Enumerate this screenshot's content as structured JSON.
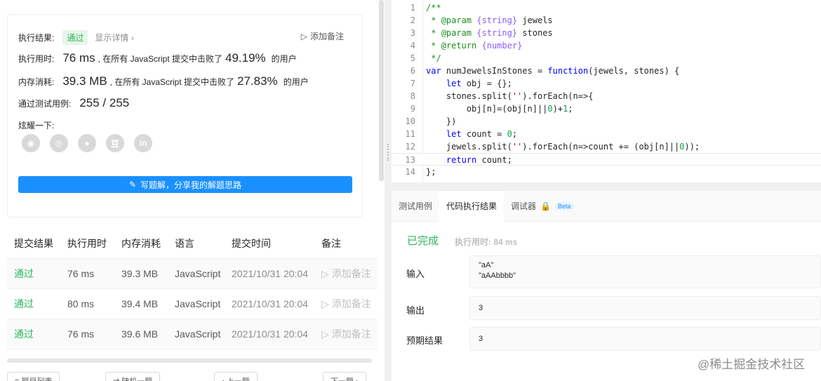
{
  "summary": {
    "result_label": "执行结果:",
    "result_value": "通过",
    "show_detail": "显示详情 ›",
    "add_note": "添加备注",
    "time_label": "执行用时:",
    "time_value": "76 ms",
    "time_text": ", 在所有 JavaScript 提交中击败了",
    "time_pct": "49.19%",
    "time_suffix": "的用户",
    "mem_label": "内存消耗:",
    "mem_value": "39.3 MB",
    "mem_text": ", 在所有 JavaScript 提交中击败了",
    "mem_pct": "27.83%",
    "mem_suffix": "的用户",
    "cases_label": "通过测试用例:",
    "cases_value": "255 / 255",
    "share_label": "炫耀一下:",
    "share_icons": [
      "wechat-icon",
      "weibo-icon",
      "qq-icon",
      "douban-icon",
      "linkedin-icon"
    ],
    "share_glyphs": [
      "◉",
      "◎",
      "●",
      "豆",
      "in"
    ],
    "write_solution": "写题解，分享我的解题思路"
  },
  "submissions": {
    "headers": [
      "提交结果",
      "执行用时",
      "内存消耗",
      "语言",
      "提交时间",
      "备注"
    ],
    "rows": [
      {
        "result": "通过",
        "time": "76 ms",
        "memory": "39.3 MB",
        "lang": "JavaScript",
        "date": "2021/10/31 20:04",
        "note": "添加备注"
      },
      {
        "result": "通过",
        "time": "80 ms",
        "memory": "39.4 MB",
        "lang": "JavaScript",
        "date": "2021/10/31 20:04",
        "note": "添加备注"
      },
      {
        "result": "通过",
        "time": "76 ms",
        "memory": "39.6 MB",
        "lang": "JavaScript",
        "date": "2021/10/31 20:04",
        "note": "添加备注"
      }
    ]
  },
  "editor": {
    "lines": [
      {
        "n": "1",
        "html": "<span class='cm'>/**</span>"
      },
      {
        "n": "2",
        "html": "<span class='cm'> * </span><span class='cm'>@param</span> <span class='ty'>{string}</span> jewels"
      },
      {
        "n": "3",
        "html": "<span class='cm'> * </span><span class='cm'>@param</span> <span class='ty'>{string}</span> stones"
      },
      {
        "n": "4",
        "html": "<span class='cm'> * </span><span class='cm'>@return</span> <span class='ty'>{number}</span>"
      },
      {
        "n": "5",
        "html": "<span class='cm'> */</span>"
      },
      {
        "n": "6",
        "html": "<span class='k'>var</span> numJewelsInStones = <span class='k'>function</span>(jewels, stones) {"
      },
      {
        "n": "7",
        "html": "    <span class='k'>let</span> obj = {};"
      },
      {
        "n": "8",
        "html": "    stones.split(<span class='st'>''</span>).forEach(n=>{"
      },
      {
        "n": "9",
        "html": "        obj[n]=(obj[n]||<span class='nm'>0</span>)+<span class='nm'>1</span>;"
      },
      {
        "n": "10",
        "html": "    })"
      },
      {
        "n": "11",
        "html": "    <span class='k'>let</span> count = <span class='nm'>0</span>;"
      },
      {
        "n": "12",
        "html": "    jewels.split(<span class='st'>''</span>).forEach(n=>count += (obj[n]||<span class='nm'>0</span>));"
      },
      {
        "n": "13",
        "html": "    <span class='k'>return</span> count;"
      },
      {
        "n": "14",
        "html": "};"
      }
    ]
  },
  "result_panel": {
    "tabs": [
      "测试用例",
      "代码执行结果",
      "调试器"
    ],
    "beta": "Beta",
    "status": "已完成",
    "exec_time": "执行用时: 84 ms",
    "input_label": "输入",
    "input_value": "\"aA\"\n\"aAAbbbb\"",
    "output_label": "输出",
    "output_value": "3",
    "expected_label": "预期结果",
    "expected_value": "3"
  },
  "bottom_bar": {
    "buttons": [
      "≡ 题目列表",
      "⇄ 随机一题",
      "‹ 上一题",
      "下一题 ›"
    ]
  },
  "watermark": "@稀土掘金技术社区",
  "colors": {
    "accent": "#1a90ff",
    "success": "#2db55d"
  }
}
